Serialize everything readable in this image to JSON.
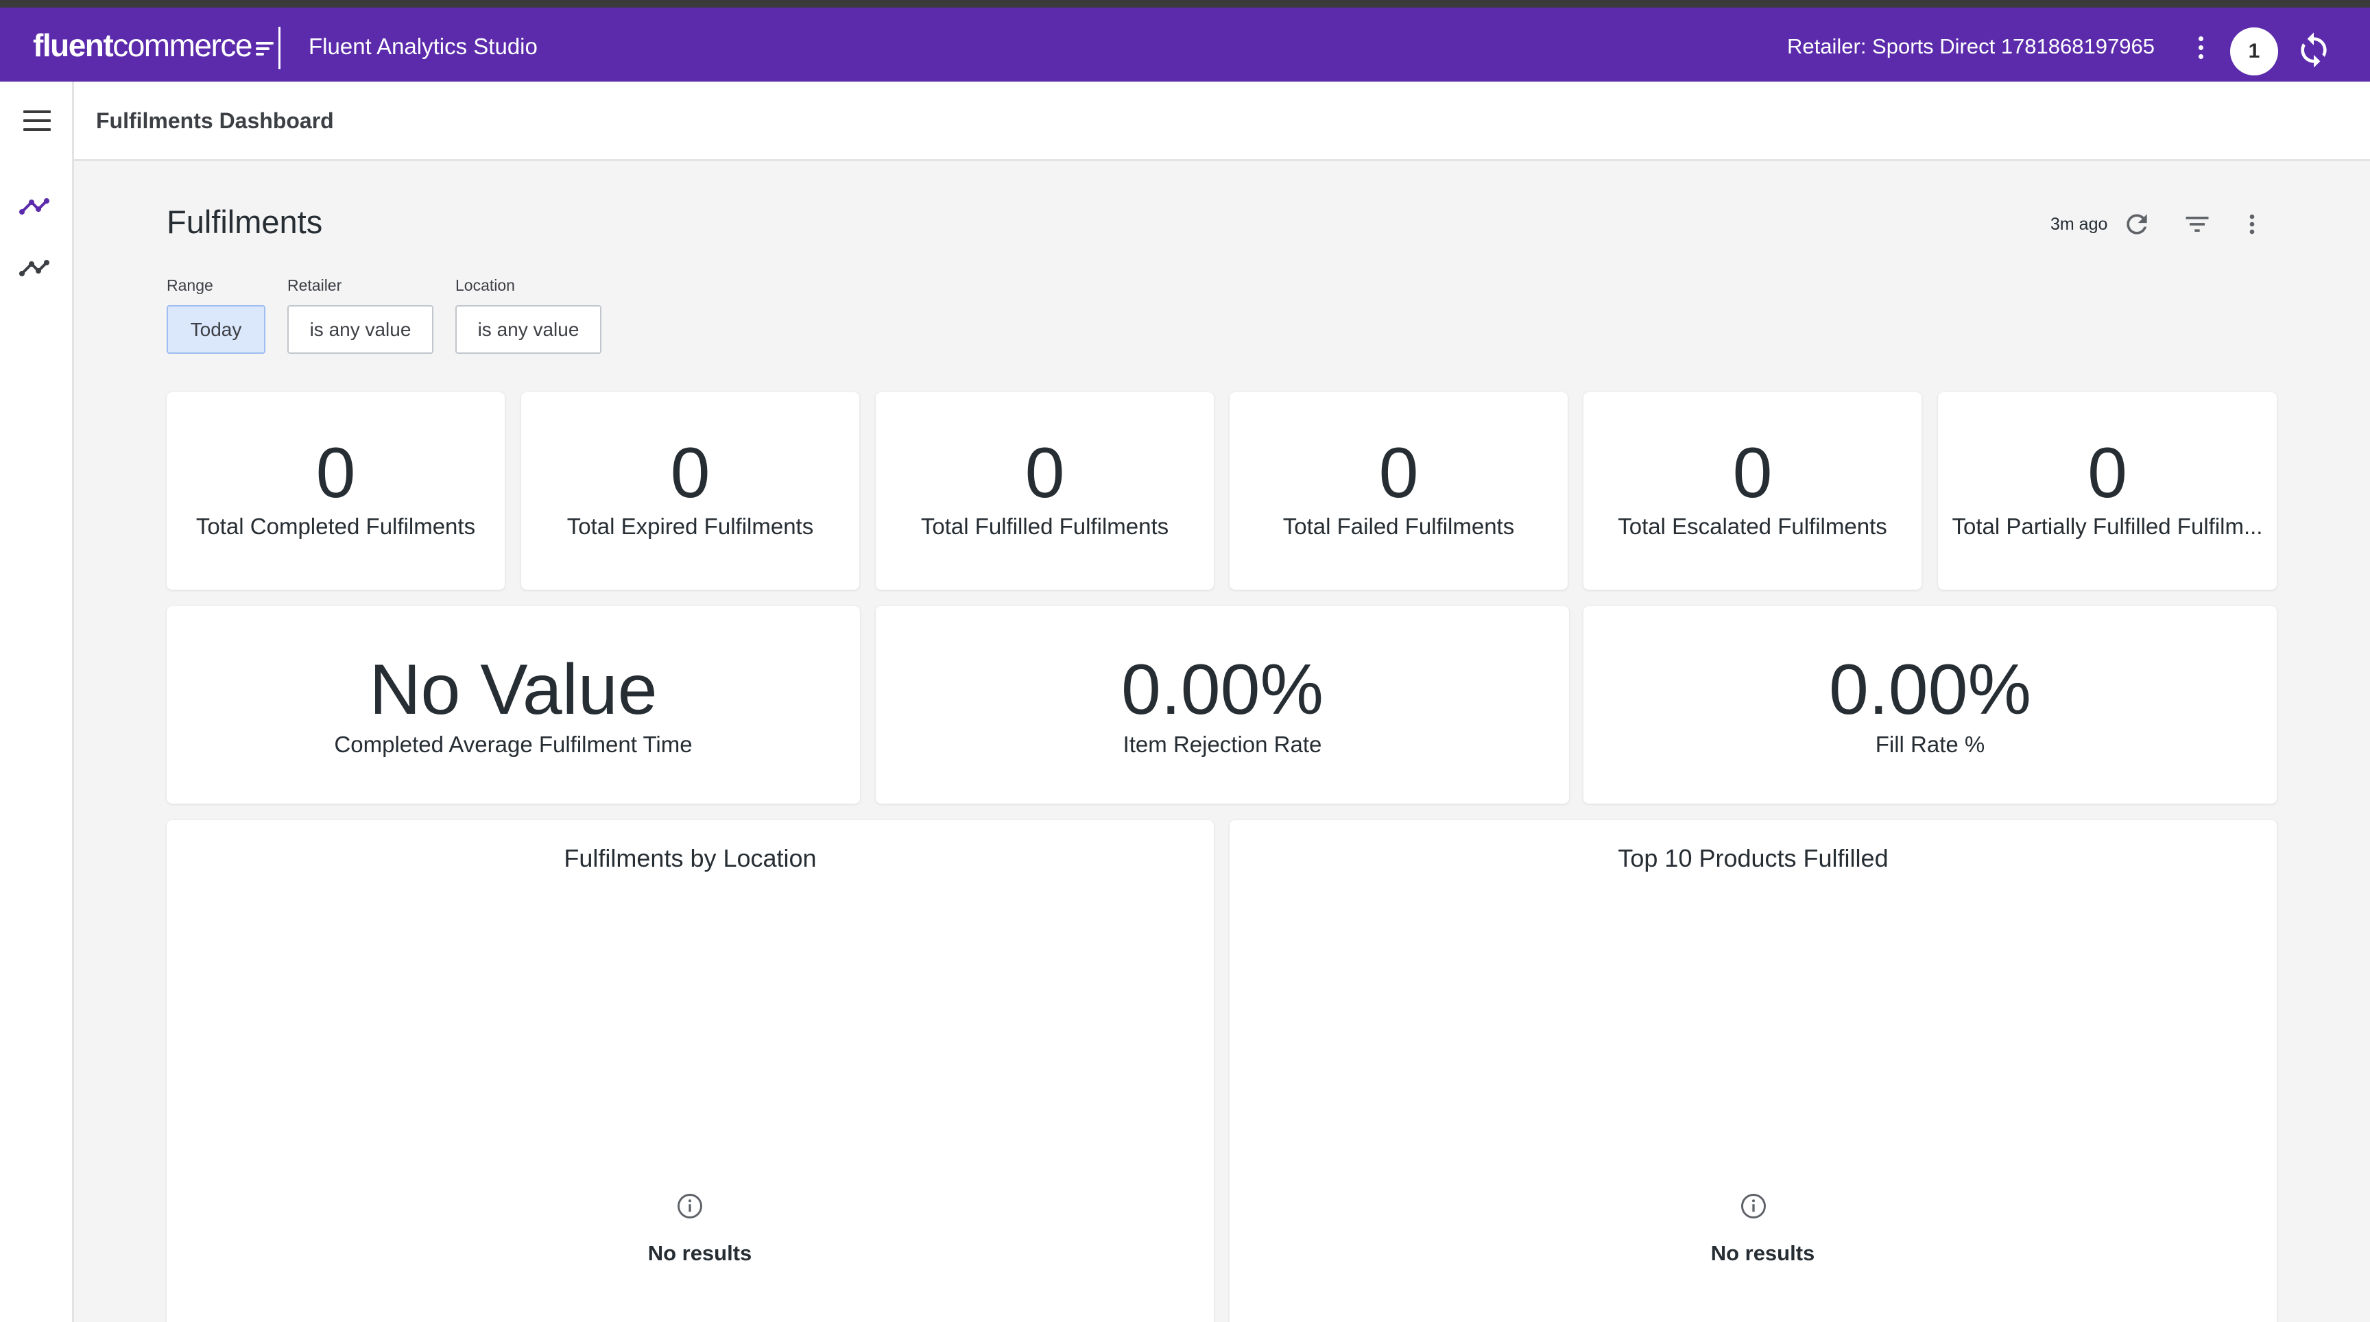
{
  "topbar": {
    "logo_bold": "fluent",
    "logo_rest": "commerce",
    "app_name": "Fluent Analytics Studio",
    "retailer": "Retailer: Sports Direct 1781868197965",
    "badge_count": "1",
    "color": "#5b2bab"
  },
  "nav": {
    "icons": [
      "menu-icon",
      "analytics-trend-icon",
      "analytics-trend-icon"
    ]
  },
  "subheader": {
    "title": "Fulfilments Dashboard"
  },
  "dashboard": {
    "title": "Fulfilments",
    "updated": "3m ago",
    "filters": [
      {
        "label": "Range",
        "value": "Today"
      },
      {
        "label": "Retailer",
        "value": "is any value"
      },
      {
        "label": "Location",
        "value": "is any value"
      }
    ],
    "kpis_row1": [
      {
        "value": "0",
        "label": "Total Completed Fulfilments"
      },
      {
        "value": "0",
        "label": "Total Expired Fulfilments"
      },
      {
        "value": "0",
        "label": "Total Fulfilled Fulfilments"
      },
      {
        "value": "0",
        "label": "Total Failed Fulfilments"
      },
      {
        "value": "0",
        "label": "Total Escalated Fulfilments"
      },
      {
        "value": "0",
        "label": "Total Partially Fulfilled Fulfilm..."
      }
    ],
    "kpis_row2": [
      {
        "value": "No Value",
        "label": "Completed Average Fulfilment Time"
      },
      {
        "value": "0.00%",
        "label": "Item Rejection Rate"
      },
      {
        "value": "0.00%",
        "label": "Fill Rate %"
      }
    ],
    "charts": [
      {
        "title": "Fulfilments by Location",
        "empty_text": "No results"
      },
      {
        "title": "Top 10 Products Fulfilled",
        "empty_text": "No results"
      }
    ]
  }
}
